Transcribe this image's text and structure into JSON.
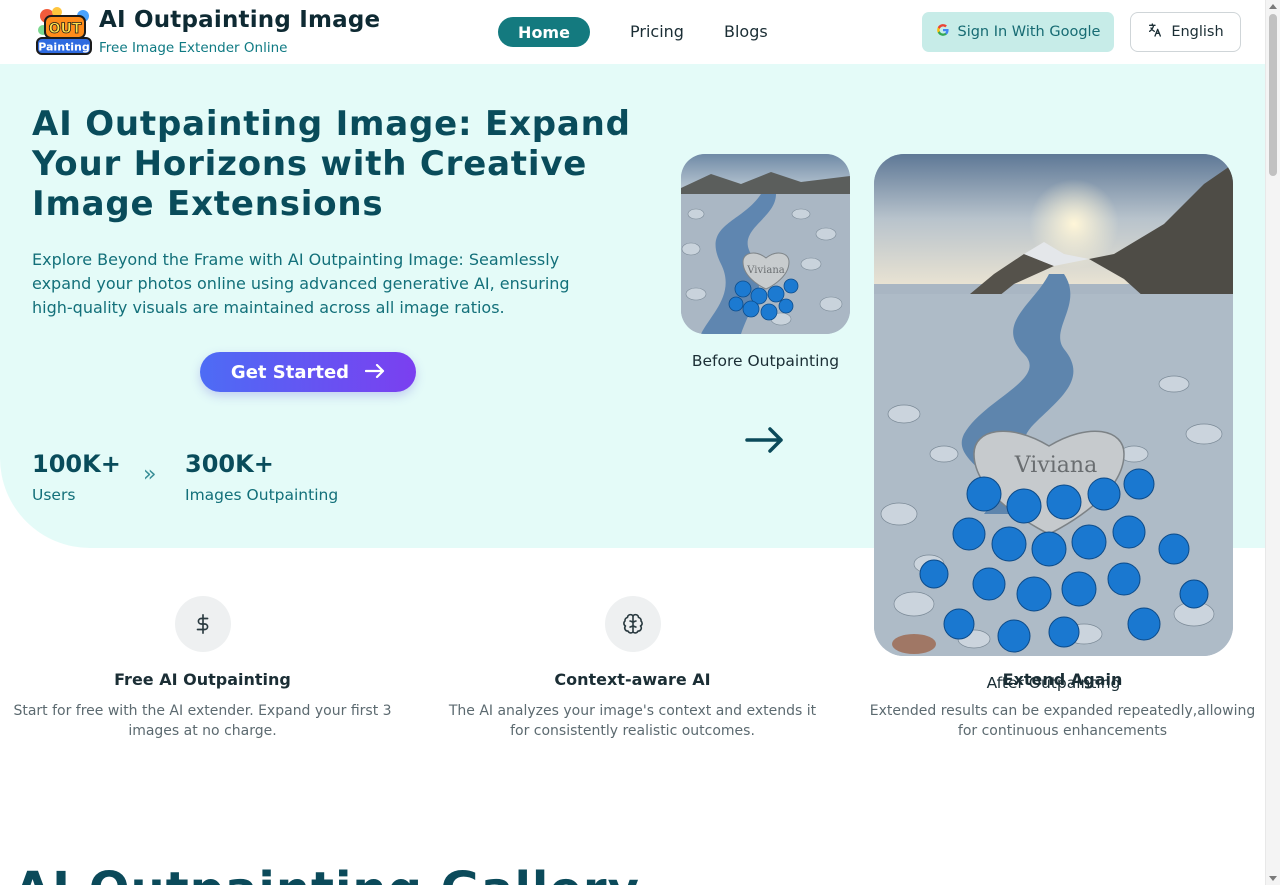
{
  "header": {
    "title": "AI Outpainting Image",
    "subtitle": "Free Image Extender Online",
    "logo_text": "OUT Painting",
    "nav": [
      {
        "label": "Home",
        "active": true
      },
      {
        "label": "Pricing"
      },
      {
        "label": "Blogs"
      }
    ],
    "sign_in_label": "Sign In With Google",
    "language_label": "English"
  },
  "hero": {
    "title": "AI Outpainting Image: Expand Your Horizons with Creative Image Extensions",
    "description": "Explore Beyond the Frame with AI Outpainting Image: Seamlessly expand your photos online using advanced generative AI, ensuring high-quality visuals are maintained across all image ratios.",
    "cta_label": "Get Started",
    "stats": [
      {
        "value": "100K+",
        "label": "Users"
      },
      {
        "value": "300K+",
        "label": "Images Outpainting"
      }
    ],
    "before_caption": "Before Outpainting",
    "after_caption": "After Outpainting",
    "stone_text": "Viviana"
  },
  "features": [
    {
      "icon": "dollar-icon",
      "title": "Free AI Outpainting",
      "description": "Start for free with the AI extender. Expand your first 3 images at no charge."
    },
    {
      "icon": "brain-icon",
      "title": "Context-aware AI",
      "description": "The AI analyzes your image's context and extends it for consistently realistic outcomes."
    },
    {
      "icon": "refresh-icon",
      "title": "Extend Again",
      "description": "Extended results can be expanded repeatedly,allowing for continuous enhancements"
    }
  ],
  "gallery": {
    "title": "AI Outpainting Gallery"
  },
  "colors": {
    "accent": "#147a7f",
    "hero_bg": "#e4fbf8",
    "heading": "#094c5b",
    "cta_start": "#4d6cf5",
    "cta_end": "#7b3ff0"
  }
}
